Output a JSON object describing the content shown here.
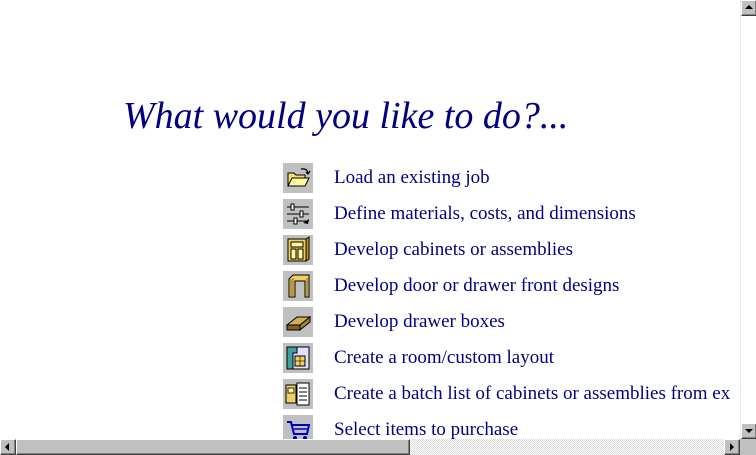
{
  "heading": "What would you like to do?...",
  "menu": [
    {
      "icon": "open-folder-icon",
      "label": "Load an existing job"
    },
    {
      "icon": "sliders-icon",
      "label": "Define materials, costs, and dimensions"
    },
    {
      "icon": "cabinet-icon",
      "label": "Develop cabinets or assemblies"
    },
    {
      "icon": "door-frame-icon",
      "label": "Develop door or drawer front designs"
    },
    {
      "icon": "drawer-box-icon",
      "label": "Develop drawer boxes"
    },
    {
      "icon": "room-layout-icon",
      "label": "Create a room/custom layout"
    },
    {
      "icon": "batch-list-icon",
      "label": "Create a batch list of cabinets or assemblies from ex"
    },
    {
      "icon": "shopping-cart-icon",
      "label": "Select items to purchase"
    }
  ],
  "colors": {
    "link": "#000080",
    "icon_bg": "#c0c0c0"
  }
}
